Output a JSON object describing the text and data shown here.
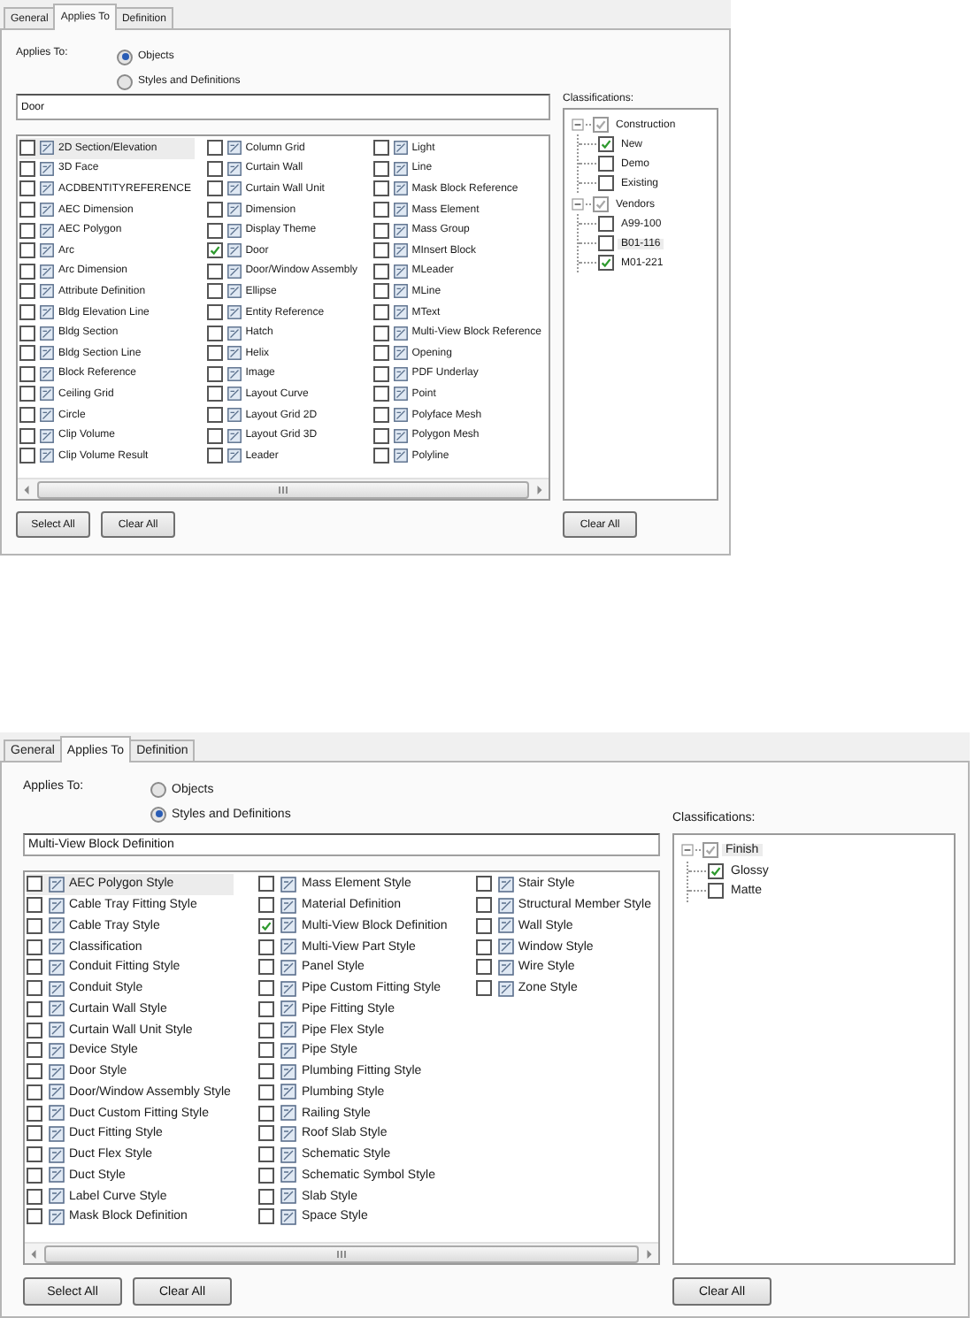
{
  "dialogs": [
    {
      "tabs": [
        {
          "label": "General",
          "selected": false
        },
        {
          "label": "Applies To",
          "selected": true
        },
        {
          "label": "Definition",
          "selected": false
        }
      ],
      "applies_to_label": "Applies To:",
      "options": [
        {
          "label": "Objects",
          "selected": true
        },
        {
          "label": "Styles and Definitions",
          "selected": false
        }
      ],
      "filter": "Door",
      "columns": [
        [
          {
            "label": "2D Section/Elevation",
            "checked": false,
            "selected": true
          },
          {
            "label": "3D Face",
            "checked": false,
            "selected": false
          },
          {
            "label": "ACDBENTITYREFERENCE",
            "checked": false,
            "selected": false
          },
          {
            "label": "AEC Dimension",
            "checked": false,
            "selected": false
          },
          {
            "label": "AEC Polygon",
            "checked": false,
            "selected": false
          },
          {
            "label": "Arc",
            "checked": false,
            "selected": false
          },
          {
            "label": "Arc Dimension",
            "checked": false,
            "selected": false
          },
          {
            "label": "Attribute Definition",
            "checked": false,
            "selected": false
          },
          {
            "label": "Bldg Elevation Line",
            "checked": false,
            "selected": false
          },
          {
            "label": "Bldg Section",
            "checked": false,
            "selected": false
          },
          {
            "label": "Bldg Section Line",
            "checked": false,
            "selected": false
          },
          {
            "label": "Block Reference",
            "checked": false,
            "selected": false
          },
          {
            "label": "Ceiling Grid",
            "checked": false,
            "selected": false
          },
          {
            "label": "Circle",
            "checked": false,
            "selected": false
          },
          {
            "label": "Clip Volume",
            "checked": false,
            "selected": false
          },
          {
            "label": "Clip Volume Result",
            "checked": false,
            "selected": false
          }
        ],
        [
          {
            "label": "Column Grid",
            "checked": false,
            "selected": false
          },
          {
            "label": "Curtain Wall",
            "checked": false,
            "selected": false
          },
          {
            "label": "Curtain Wall Unit",
            "checked": false,
            "selected": false
          },
          {
            "label": "Dimension",
            "checked": false,
            "selected": false
          },
          {
            "label": "Display Theme",
            "checked": false,
            "selected": false
          },
          {
            "label": "Door",
            "checked": true,
            "selected": false
          },
          {
            "label": "Door/Window Assembly",
            "checked": false,
            "selected": false
          },
          {
            "label": "Ellipse",
            "checked": false,
            "selected": false
          },
          {
            "label": "Entity Reference",
            "checked": false,
            "selected": false
          },
          {
            "label": "Hatch",
            "checked": false,
            "selected": false
          },
          {
            "label": "Helix",
            "checked": false,
            "selected": false
          },
          {
            "label": "Image",
            "checked": false,
            "selected": false
          },
          {
            "label": "Layout Curve",
            "checked": false,
            "selected": false
          },
          {
            "label": "Layout Grid 2D",
            "checked": false,
            "selected": false
          },
          {
            "label": "Layout Grid 3D",
            "checked": false,
            "selected": false
          },
          {
            "label": "Leader",
            "checked": false,
            "selected": false
          }
        ],
        [
          {
            "label": "Light",
            "checked": false,
            "selected": false
          },
          {
            "label": "Line",
            "checked": false,
            "selected": false
          },
          {
            "label": "Mask Block Reference",
            "checked": false,
            "selected": false
          },
          {
            "label": "Mass Element",
            "checked": false,
            "selected": false
          },
          {
            "label": "Mass Group",
            "checked": false,
            "selected": false
          },
          {
            "label": "MInsert Block",
            "checked": false,
            "selected": false
          },
          {
            "label": "MLeader",
            "checked": false,
            "selected": false
          },
          {
            "label": "MLine",
            "checked": false,
            "selected": false
          },
          {
            "label": "MText",
            "checked": false,
            "selected": false
          },
          {
            "label": "Multi-View Block Reference",
            "checked": false,
            "selected": false
          },
          {
            "label": "Opening",
            "checked": false,
            "selected": false
          },
          {
            "label": "PDF Underlay",
            "checked": false,
            "selected": false
          },
          {
            "label": "Point",
            "checked": false,
            "selected": false
          },
          {
            "label": "Polyface Mesh",
            "checked": false,
            "selected": false
          },
          {
            "label": "Polygon Mesh",
            "checked": false,
            "selected": false
          },
          {
            "label": "Polyline",
            "checked": false,
            "selected": false
          }
        ]
      ],
      "buttons": [
        "Select All",
        "Clear All"
      ],
      "classifications_label": "Classifications:",
      "tree": [
        {
          "label": "Construction",
          "checked": true,
          "mixed": true,
          "expanded": true,
          "selected": false,
          "children": [
            {
              "label": "New",
              "checked": true,
              "selected": false
            },
            {
              "label": "Demo",
              "checked": false,
              "selected": false
            },
            {
              "label": "Existing",
              "checked": false,
              "selected": false
            }
          ]
        },
        {
          "label": "Vendors",
          "checked": true,
          "mixed": true,
          "expanded": true,
          "selected": false,
          "children": [
            {
              "label": "A99-100",
              "checked": false,
              "selected": false
            },
            {
              "label": "B01-116",
              "checked": false,
              "selected": true
            },
            {
              "label": "M01-221",
              "checked": true,
              "selected": false
            }
          ]
        }
      ],
      "tree_button": "Clear All"
    },
    {
      "tabs": [
        {
          "label": "General",
          "selected": false
        },
        {
          "label": "Applies To",
          "selected": true
        },
        {
          "label": "Definition",
          "selected": false
        }
      ],
      "applies_to_label": "Applies To:",
      "options": [
        {
          "label": "Objects",
          "selected": false
        },
        {
          "label": "Styles and Definitions",
          "selected": true
        }
      ],
      "filter": "Multi-View Block Definition",
      "columns": [
        [
          {
            "label": "AEC Polygon Style",
            "checked": false,
            "selected": true
          },
          {
            "label": "Cable Tray Fitting Style",
            "checked": false,
            "selected": false
          },
          {
            "label": "Cable Tray Style",
            "checked": false,
            "selected": false
          },
          {
            "label": "Classification",
            "checked": false,
            "selected": false
          },
          {
            "label": "Conduit Fitting Style",
            "checked": false,
            "selected": false
          },
          {
            "label": "Conduit Style",
            "checked": false,
            "selected": false
          },
          {
            "label": "Curtain Wall Style",
            "checked": false,
            "selected": false
          },
          {
            "label": "Curtain Wall Unit Style",
            "checked": false,
            "selected": false
          },
          {
            "label": "Device Style",
            "checked": false,
            "selected": false
          },
          {
            "label": "Door Style",
            "checked": false,
            "selected": false
          },
          {
            "label": "Door/Window Assembly Style",
            "checked": false,
            "selected": false
          },
          {
            "label": "Duct Custom Fitting Style",
            "checked": false,
            "selected": false
          },
          {
            "label": "Duct Fitting Style",
            "checked": false,
            "selected": false
          },
          {
            "label": "Duct Flex Style",
            "checked": false,
            "selected": false
          },
          {
            "label": "Duct Style",
            "checked": false,
            "selected": false
          },
          {
            "label": "Label Curve Style",
            "checked": false,
            "selected": false
          },
          {
            "label": "Mask Block Definition",
            "checked": false,
            "selected": false
          }
        ],
        [
          {
            "label": "Mass Element Style",
            "checked": false,
            "selected": false
          },
          {
            "label": "Material Definition",
            "checked": false,
            "selected": false
          },
          {
            "label": "Multi-View Block Definition",
            "checked": true,
            "selected": false
          },
          {
            "label": "Multi-View Part Style",
            "checked": false,
            "selected": false
          },
          {
            "label": "Panel Style",
            "checked": false,
            "selected": false
          },
          {
            "label": "Pipe Custom Fitting Style",
            "checked": false,
            "selected": false
          },
          {
            "label": "Pipe Fitting Style",
            "checked": false,
            "selected": false
          },
          {
            "label": "Pipe Flex Style",
            "checked": false,
            "selected": false
          },
          {
            "label": "Pipe Style",
            "checked": false,
            "selected": false
          },
          {
            "label": "Plumbing Fitting Style",
            "checked": false,
            "selected": false
          },
          {
            "label": "Plumbing Style",
            "checked": false,
            "selected": false
          },
          {
            "label": "Railing Style",
            "checked": false,
            "selected": false
          },
          {
            "label": "Roof Slab Style",
            "checked": false,
            "selected": false
          },
          {
            "label": "Schematic Style",
            "checked": false,
            "selected": false
          },
          {
            "label": "Schematic Symbol Style",
            "checked": false,
            "selected": false
          },
          {
            "label": "Slab Style",
            "checked": false,
            "selected": false
          },
          {
            "label": "Space Style",
            "checked": false,
            "selected": false
          }
        ],
        [
          {
            "label": "Stair Style",
            "checked": false,
            "selected": false
          },
          {
            "label": "Structural Member Style",
            "checked": false,
            "selected": false
          },
          {
            "label": "Wall Style",
            "checked": false,
            "selected": false
          },
          {
            "label": "Window Style",
            "checked": false,
            "selected": false
          },
          {
            "label": "Wire Style",
            "checked": false,
            "selected": false
          },
          {
            "label": "Zone Style",
            "checked": false,
            "selected": false
          }
        ]
      ],
      "buttons": [
        "Select All",
        "Clear All"
      ],
      "classifications_label": "Classifications:",
      "tree": [
        {
          "label": "Finish",
          "checked": true,
          "mixed": true,
          "expanded": true,
          "selected": true,
          "children": [
            {
              "label": "Glossy",
              "checked": true,
              "selected": false
            },
            {
              "label": "Matte",
              "checked": false,
              "selected": false
            }
          ]
        }
      ],
      "tree_button": "Clear All"
    }
  ]
}
